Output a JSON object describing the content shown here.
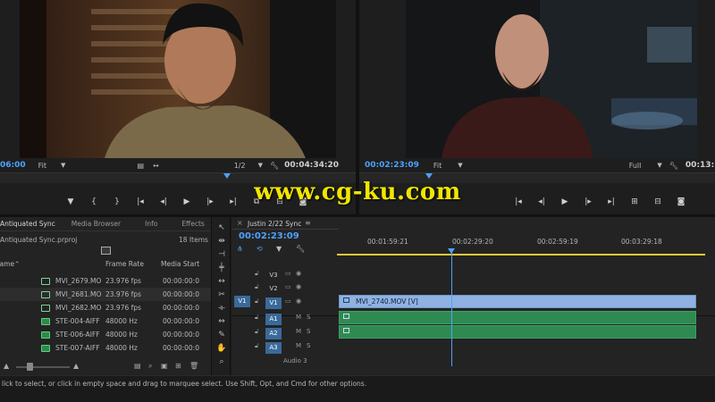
{
  "source_monitor": {
    "timecode_in": "06:00",
    "fit": "Fit",
    "resolution": "1/2",
    "timecode_out": "00:04:34:20"
  },
  "program_monitor": {
    "timecode": "00:02:23:09",
    "fit": "Fit",
    "resolution": "Full",
    "timecode_out": "00:13:"
  },
  "project_panel": {
    "tabs": [
      "Antiquated Sync",
      "Media Browser",
      "Info",
      "Effects"
    ],
    "project_file": "Antiquated Sync.prproj",
    "item_count": "18 Items",
    "columns": [
      "Name",
      "Frame Rate",
      "Media Start"
    ],
    "rows": [
      {
        "name": "MVI_2679.MO",
        "rate": "23.976 fps",
        "start": "00:00:00:0",
        "type": "video"
      },
      {
        "name": "MVI_2681.MO",
        "rate": "23.976 fps",
        "start": "00:00:00:0",
        "type": "video"
      },
      {
        "name": "MVI_2682.MO",
        "rate": "23.976 fps",
        "start": "00:00:00:0",
        "type": "video"
      },
      {
        "name": "STE-004-AIFF",
        "rate": "48000 Hz",
        "start": "00:00:00:0",
        "type": "audio"
      },
      {
        "name": "STE-006-AIFF",
        "rate": "48000 Hz",
        "start": "00:00:00:0",
        "type": "audio"
      },
      {
        "name": "STE-007-AIFF",
        "rate": "48000 Hz",
        "start": "00:00:00:0",
        "type": "audio"
      }
    ]
  },
  "timeline": {
    "tab": "Justin 2/22 Sync",
    "timecode": "00:02:23:09",
    "ruler_labels": [
      "00:01:59:21",
      "00:02:29:20",
      "00:02:59:19",
      "00:03:29:18"
    ],
    "tracks": [
      {
        "name": "V3",
        "on": false
      },
      {
        "name": "V2",
        "on": false
      },
      {
        "name": "V1",
        "on": true
      },
      {
        "name": "A1",
        "on": true
      },
      {
        "name": "A2",
        "on": true
      },
      {
        "name": "A3",
        "on": true
      }
    ],
    "source_patch_v": "V1",
    "video_clip": "MVI_2740.MOV [V]",
    "audio3_label": "Audio 3"
  },
  "status_text": "lick to select, or click in empty space and drag to marquee select. Use Shift, Opt, and Cmd for other options.",
  "watermark": "www.cg-ku.com",
  "colors": {
    "accent_blue": "#4ea2ff",
    "video_clip": "#8fb2e2",
    "audio_clip": "#2f8a52",
    "watermark": "#f2e600"
  }
}
